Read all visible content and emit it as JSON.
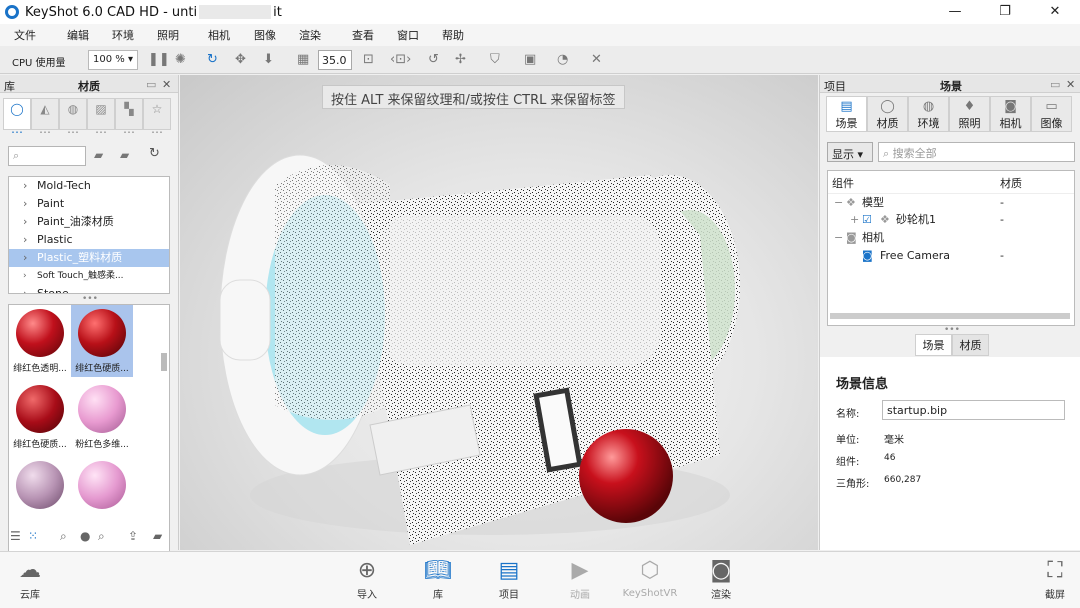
{
  "window": {
    "title_prefix": "KeyShot 6.0 CAD HD  - unti",
    "title_suffix": "it",
    "min": "—",
    "max": "❐",
    "close": "✕"
  },
  "menu": [
    "文件",
    "编辑",
    "环境",
    "照明",
    "相机",
    "图像",
    "渲染",
    "查看",
    "窗口",
    "帮助"
  ],
  "toolbar": {
    "cpu_label": "CPU 使用量",
    "zoom": "100 %",
    "fov": "35.0"
  },
  "library": {
    "title_left": "库",
    "title": "材质",
    "tree": [
      "Mold-Tech",
      "Paint",
      "Paint_油漆材质",
      "Plastic",
      "Plastic_塑料材质",
      "Soft Touch_触感柔...",
      "Stone"
    ],
    "selected_index": 4,
    "materials": [
      {
        "caption": "绯红色透明...",
        "color": "#c0101c",
        "selected": false
      },
      {
        "caption": "绯红色硬质...",
        "color": "#b81018",
        "selected": true
      },
      {
        "caption": "绯红色硬质...",
        "color": "#a80c18",
        "selected": false
      },
      {
        "caption": "粉红色多维...",
        "color": "#e89ad0",
        "selected": false
      },
      {
        "caption": "",
        "color": "#b894b4",
        "selected": false
      },
      {
        "caption": "",
        "color": "#e59ad0",
        "selected": false
      }
    ]
  },
  "viewport": {
    "hint": "按住 ALT 来保留纹理和/或按住 CTRL 来保留标签"
  },
  "project": {
    "title_left": "项目",
    "title": "场景",
    "tabs": [
      "场景",
      "材质",
      "环境",
      "照明",
      "相机",
      "图像"
    ],
    "display_btn": "显示",
    "search_placeholder": "搜索全部",
    "col_component": "组件",
    "col_material": "材质",
    "tree": [
      {
        "label": "模型",
        "mat": "-"
      },
      {
        "label": "砂轮机1",
        "mat": "-"
      },
      {
        "label": "相机",
        "mat": ""
      },
      {
        "label": "Free Camera",
        "mat": "-"
      }
    ],
    "subtabs": [
      "场景",
      "材质"
    ],
    "info_title": "场景信息",
    "name_label": "名称:",
    "name_value": "startup.bip",
    "unit_label": "单位:",
    "unit_value": "毫米",
    "comp_label": "组件:",
    "comp_value": "46",
    "tri_label": "三角形:",
    "tri_value": "660,287"
  },
  "dock": {
    "cloud": "云库",
    "import": "导入",
    "library": "库",
    "project": "项目",
    "animation": "动画",
    "vr": "KeyShotVR",
    "render": "渲染",
    "screenshot": "截屏"
  }
}
